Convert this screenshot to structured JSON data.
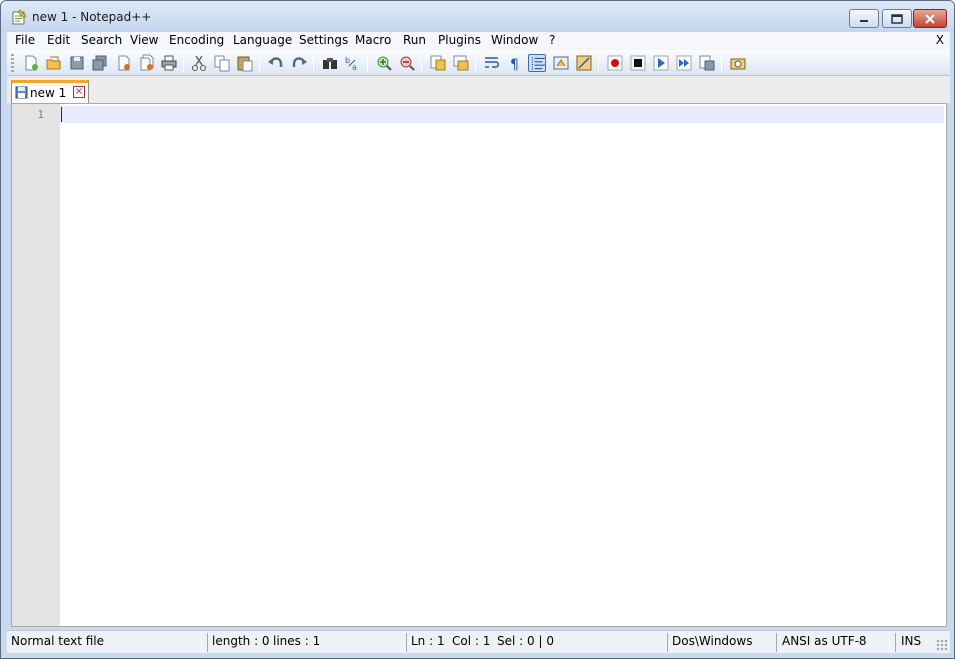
{
  "window": {
    "title": "new 1 - Notepad++"
  },
  "menubar": {
    "items": [
      "File",
      "Edit",
      "Search",
      "View",
      "Encoding",
      "Language",
      "Settings",
      "Macro",
      "Run",
      "Plugins",
      "Window",
      "?"
    ],
    "close_label": "X"
  },
  "toolbar": {
    "buttons": [
      {
        "icon": "new-file-icon"
      },
      {
        "icon": "open-file-icon"
      },
      {
        "icon": "save-icon"
      },
      {
        "icon": "save-all-icon"
      },
      {
        "icon": "close-icon"
      },
      {
        "icon": "close-all-icon"
      },
      {
        "icon": "print-icon"
      },
      {
        "icon": "cut-icon"
      },
      {
        "icon": "copy-icon"
      },
      {
        "icon": "paste-icon"
      },
      {
        "icon": "undo-icon"
      },
      {
        "icon": "redo-icon"
      },
      {
        "icon": "find-icon"
      },
      {
        "icon": "replace-icon"
      },
      {
        "icon": "zoom-in-icon"
      },
      {
        "icon": "zoom-out-icon"
      },
      {
        "icon": "sync-vertical-icon"
      },
      {
        "icon": "sync-horizontal-icon"
      },
      {
        "icon": "word-wrap-icon"
      },
      {
        "icon": "show-all-chars-icon"
      },
      {
        "icon": "indent-guide-icon"
      },
      {
        "icon": "user-language-icon"
      },
      {
        "icon": "doc-map-icon"
      },
      {
        "icon": "record-macro-icon"
      },
      {
        "icon": "stop-macro-icon"
      },
      {
        "icon": "play-macro-icon"
      },
      {
        "icon": "play-multiple-macro-icon"
      },
      {
        "icon": "save-macro-icon"
      },
      {
        "icon": "spell-check-icon"
      }
    ]
  },
  "tabs": [
    {
      "label": "new  1",
      "close": "×"
    }
  ],
  "editor": {
    "line_numbers": [
      "1"
    ]
  },
  "statusbar": {
    "file_type": "Normal text file",
    "length": "length : 0",
    "lines": "lines : 1",
    "ln": "Ln : 1",
    "col": "Col : 1",
    "sel": "Sel : 0 | 0",
    "eol": "Dos\\Windows",
    "encoding": "ANSI as UTF-8",
    "mode": "INS"
  },
  "colors": {
    "current_line": "#e8e8ff",
    "tab_accent": "#f5a623",
    "caret": "#8b0000"
  }
}
